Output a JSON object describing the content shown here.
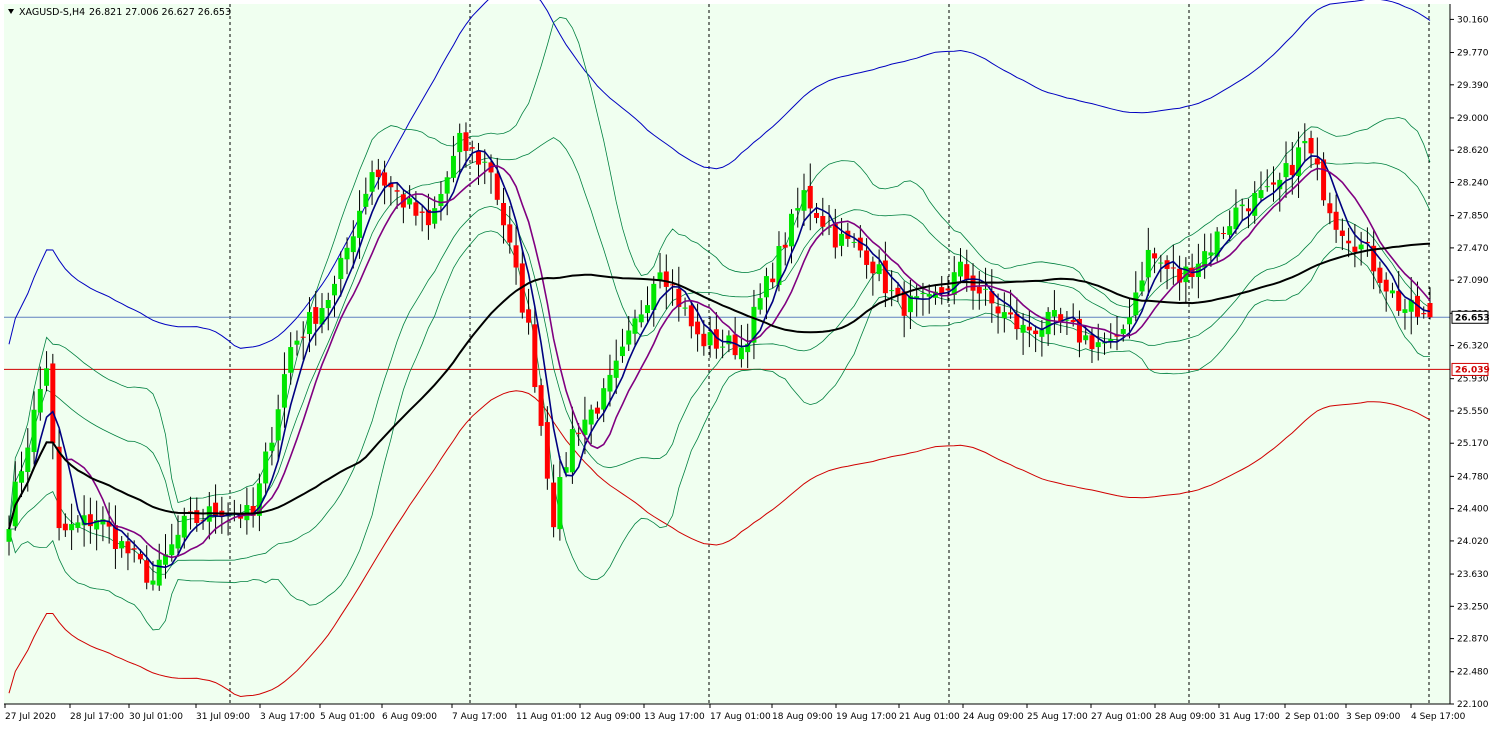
{
  "header": {
    "symbol": "XAGUSD-S,H4",
    "ohlc": "26.821 27.006 26.627 26.653"
  },
  "price_tags": {
    "bid": "26.653",
    "level": "26.039"
  },
  "colors": {
    "background": "#F0FFF0",
    "bull_candle": "#00E600",
    "bear_candle": "#FF0000",
    "wick": "#000000",
    "bollinger": "#008040",
    "ma_fast": "#000080",
    "ma_mid": "#800080",
    "ma_slow": "#000000",
    "envelope_upper": "#0000C0",
    "envelope_lower": "#D00000",
    "bid_line": "#6080C0",
    "level_line": "#D00000"
  },
  "chart_data": {
    "type": "candlestick",
    "title": "XAGUSD-S,H4",
    "ylim": [
      22.1,
      30.2
    ],
    "yticks": [
      "30.160",
      "29.770",
      "29.390",
      "29.000",
      "28.620",
      "28.240",
      "27.850",
      "27.470",
      "27.090",
      "26.700",
      "26.320",
      "25.930",
      "25.550",
      "25.170",
      "24.780",
      "24.400",
      "24.020",
      "23.630",
      "23.250",
      "22.870",
      "22.480",
      "22.100"
    ],
    "xticks": [
      "27 Jul 2020",
      "28 Jul 17:00",
      "30 Jul 01:00",
      "31 Jul 09:00",
      "3 Aug 17:00",
      "5 Aug 01:00",
      "6 Aug 09:00",
      "7 Aug 17:00",
      "11 Aug 01:00",
      "12 Aug 09:00",
      "13 Aug 17:00",
      "17 Aug 01:00",
      "18 Aug 09:00",
      "19 Aug 17:00",
      "21 Aug 01:00",
      "24 Aug 09:00",
      "25 Aug 17:00",
      "27 Aug 01:00",
      "28 Aug 09:00",
      "31 Aug 17:00",
      "2 Sep 01:00",
      "3 Sep 09:00",
      "4 Sep 17:00"
    ],
    "grid": false,
    "bid": 26.653,
    "horizontal_level": 26.039,
    "last_candle_ohlc": [
      26.821,
      27.006,
      26.627,
      26.653
    ],
    "anchors": [
      [
        0,
        24.3
      ],
      [
        6,
        26.1
      ],
      [
        8,
        24.1
      ],
      [
        14,
        24.3
      ],
      [
        23,
        23.55
      ],
      [
        28,
        24.2
      ],
      [
        34,
        24.4
      ],
      [
        39,
        24.3
      ],
      [
        45,
        26.3
      ],
      [
        52,
        27.0
      ],
      [
        58,
        28.4
      ],
      [
        62,
        28.1
      ],
      [
        67,
        27.7
      ],
      [
        72,
        28.7
      ],
      [
        77,
        28.4
      ],
      [
        83,
        26.5
      ],
      [
        87,
        24.3
      ],
      [
        90,
        25.3
      ],
      [
        95,
        25.7
      ],
      [
        98,
        26.2
      ],
      [
        104,
        27.3
      ],
      [
        110,
        26.4
      ],
      [
        117,
        26.3
      ],
      [
        122,
        27.2
      ],
      [
        127,
        28.1
      ],
      [
        132,
        27.6
      ],
      [
        137,
        27.4
      ],
      [
        142,
        26.8
      ],
      [
        147,
        26.8
      ],
      [
        152,
        27.2
      ],
      [
        157,
        26.8
      ],
      [
        162,
        26.5
      ],
      [
        167,
        26.6
      ],
      [
        172,
        26.4
      ],
      [
        177,
        26.3
      ],
      [
        182,
        27.4
      ],
      [
        187,
        27.1
      ],
      [
        192,
        27.5
      ],
      [
        197,
        28.0
      ],
      [
        202,
        28.1
      ],
      [
        207,
        28.7
      ],
      [
        212,
        27.8
      ],
      [
        217,
        27.4
      ],
      [
        222,
        26.8
      ],
      [
        227,
        26.6
      ]
    ],
    "mas": [
      {
        "name": "",
        "period": 5,
        "color": "#000080"
      },
      {
        "name": "",
        "period": 10,
        "color": "#800080"
      },
      {
        "name": "",
        "period": 50,
        "color": "#000000"
      }
    ]
  }
}
